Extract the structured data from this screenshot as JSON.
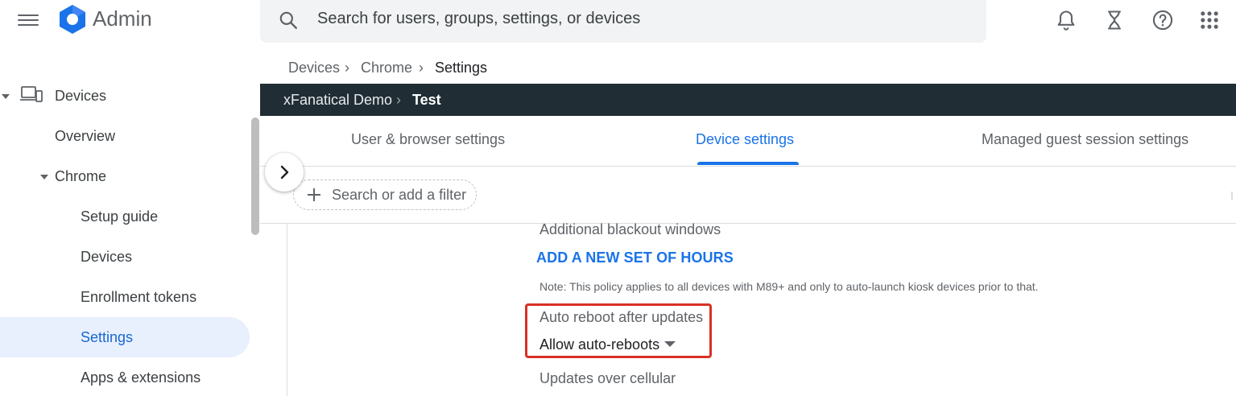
{
  "app": {
    "title": "Admin"
  },
  "search": {
    "placeholder": "Search for users, groups, settings, or devices"
  },
  "breadcrumb": [
    {
      "label": "Devices"
    },
    {
      "label": "Chrome"
    },
    {
      "label": "Settings"
    }
  ],
  "org_path": {
    "parent": "xFanatical Demo",
    "current": "Test"
  },
  "tabs": [
    {
      "label": "User & browser settings"
    },
    {
      "label": "Device settings",
      "active": true
    },
    {
      "label": "Managed guest session settings"
    }
  ],
  "filter": {
    "label": "Search or add a filter"
  },
  "sidebar": {
    "devices": "Devices",
    "overview": "Overview",
    "chrome": "Chrome",
    "setup_guide": "Setup guide",
    "devices_sub": "Devices",
    "enrollment_tokens": "Enrollment tokens",
    "settings": "Settings",
    "apps_extensions": "Apps & extensions"
  },
  "content": {
    "blackout_label": "Additional blackout windows",
    "add_hours": "ADD A NEW SET OF HOURS",
    "note": "Note: This policy applies to all devices with M89+ and only to auto-launch kiosk devices prior to that.",
    "auto_reboot_label": "Auto reboot after updates",
    "auto_reboot_value": "Allow auto-reboots",
    "cellular_label": "Updates over cellular"
  },
  "colors": {
    "accent": "#1a73e8",
    "org_bar": "#202d34",
    "highlight": "#d93025"
  }
}
